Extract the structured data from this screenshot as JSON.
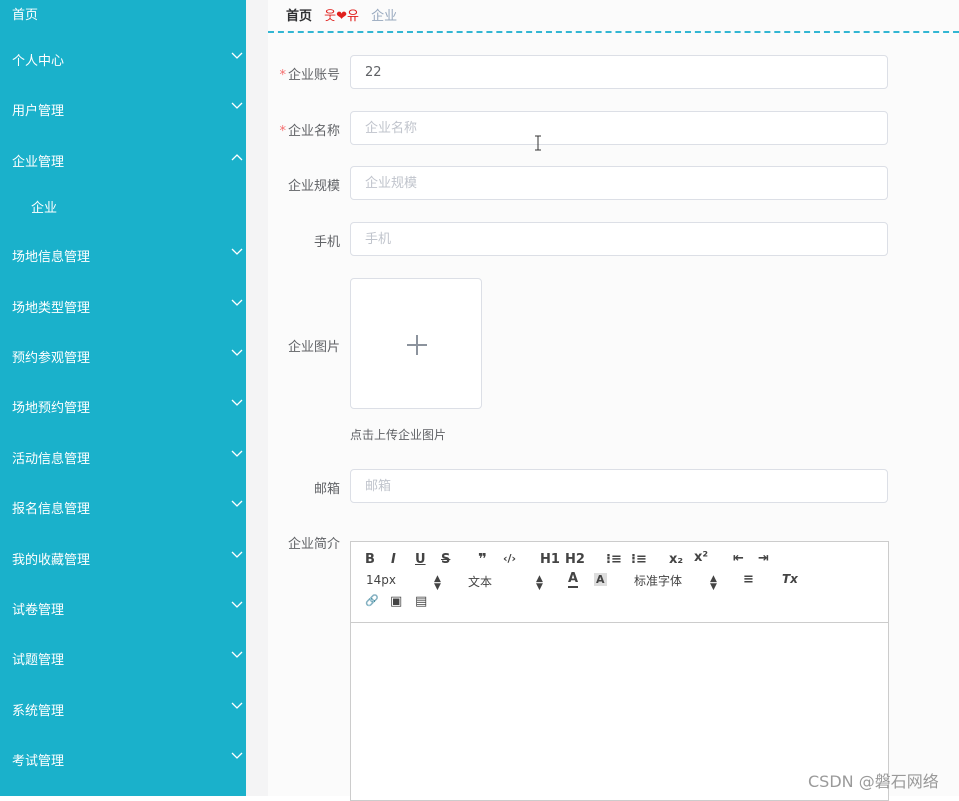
{
  "sidebar": {
    "items": [
      {
        "label": "首页",
        "expandable": false
      },
      {
        "label": "个人中心",
        "expandable": true
      },
      {
        "label": "用户管理",
        "expandable": true
      },
      {
        "label": "企业管理",
        "expandable": true,
        "expanded": true
      },
      {
        "label": "企业",
        "sub": true
      },
      {
        "label": "场地信息管理",
        "expandable": true
      },
      {
        "label": "场地类型管理",
        "expandable": true
      },
      {
        "label": "预约参观管理",
        "expandable": true
      },
      {
        "label": "场地预约管理",
        "expandable": true
      },
      {
        "label": "活动信息管理",
        "expandable": true
      },
      {
        "label": "报名信息管理",
        "expandable": true
      },
      {
        "label": "我的收藏管理",
        "expandable": true
      },
      {
        "label": "试卷管理",
        "expandable": true
      },
      {
        "label": "试题管理",
        "expandable": true
      },
      {
        "label": "系统管理",
        "expandable": true
      },
      {
        "label": "考试管理",
        "expandable": true
      }
    ],
    "colors": {
      "background": "#1ab1cb",
      "text": "#ffffff"
    }
  },
  "breadcrumb": {
    "home": "首页",
    "separator_left": "웃",
    "separator_heart": "❤",
    "separator_right": "유",
    "current": "企业"
  },
  "form": {
    "account": {
      "label": "企业账号",
      "required": true,
      "value": "22",
      "placeholder": "企业账号"
    },
    "name": {
      "label": "企业名称",
      "required": true,
      "value": "",
      "placeholder": "企业名称"
    },
    "scale": {
      "label": "企业规模",
      "required": false,
      "value": "",
      "placeholder": "企业规模"
    },
    "phone": {
      "label": "手机",
      "required": false,
      "value": "",
      "placeholder": "手机"
    },
    "image": {
      "label": "企业图片",
      "tip": "点击上传企业图片"
    },
    "email": {
      "label": "邮箱",
      "required": false,
      "value": "",
      "placeholder": "邮箱"
    },
    "intro": {
      "label": "企业简介"
    }
  },
  "editor": {
    "toolbar": {
      "bold": "B",
      "italic": "I",
      "underline": "U",
      "strike": "S",
      "blockquote": "❞",
      "code": "‹/›",
      "h1": "H1",
      "h2": "H2",
      "ordered_list": "⁝≡",
      "bullet_list": "⁝≡",
      "subscript": "x₂",
      "superscript": "x²",
      "outdent": "⇤",
      "indent": "⇥",
      "size_select": "14px",
      "header_select": "文本",
      "font_color": "A",
      "background_color": "A",
      "font_select": "标准字体",
      "align": "≡",
      "clean": "Tx",
      "link": "🔗",
      "image": "▣",
      "video": "▤"
    }
  },
  "watermark": "CSDN @磐石网络",
  "colors": {
    "accent": "#1ab1cb",
    "required": "#f56c6c",
    "dashed": "#32b6d3"
  }
}
